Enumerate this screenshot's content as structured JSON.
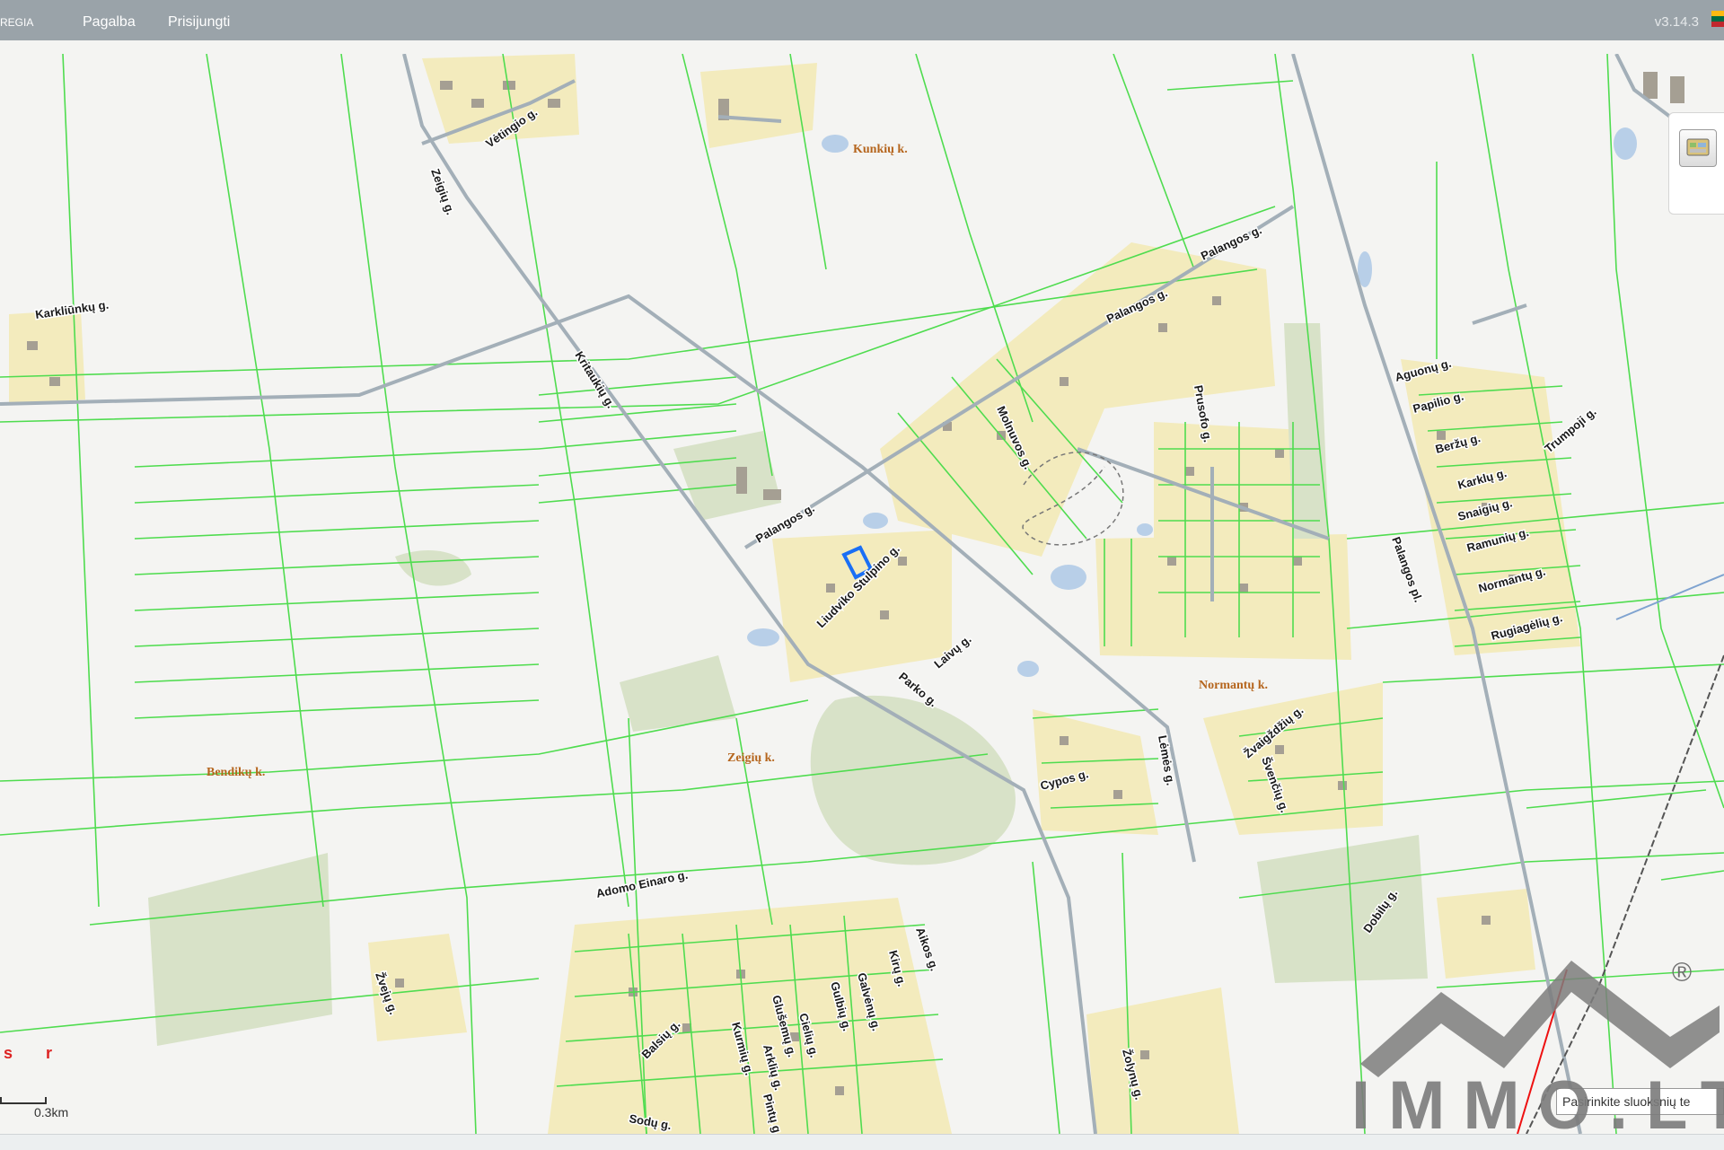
{
  "header": {
    "app_name": "REGIA",
    "menu": [
      {
        "label": "Pagalba"
      },
      {
        "label": "Prisijungti"
      }
    ],
    "version": "v3.14.3"
  },
  "map": {
    "colors": {
      "background": "#f4f4f2",
      "parcel_line": "#4fdc4f",
      "road": "#a3afb8",
      "residential": "#f3ebbd",
      "vegetation": "#d8e2c8",
      "water": "#b8cfe8",
      "building": "#a59f93",
      "village_label": "#b5651d",
      "selection": "#1a6ff5"
    },
    "village_labels": [
      {
        "text": "Kunkių k."
      },
      {
        "text": "Normantų k."
      },
      {
        "text": "Zeigių k."
      },
      {
        "text": "Bendikų k."
      }
    ],
    "street_labels": [
      {
        "text": "Vėtingio g."
      },
      {
        "text": "Zeigių g."
      },
      {
        "text": "Karkliūnkų g."
      },
      {
        "text": "Palangos g."
      },
      {
        "text": "Palangos g."
      },
      {
        "text": "Palangos g."
      },
      {
        "text": "Kritaukių g."
      },
      {
        "text": "Molnuvos g."
      },
      {
        "text": "Prusofo g."
      },
      {
        "text": "Aguonų g."
      },
      {
        "text": "Papilio g."
      },
      {
        "text": "Beržų g."
      },
      {
        "text": "Karklų g."
      },
      {
        "text": "Snaigių g."
      },
      {
        "text": "Ramunių g."
      },
      {
        "text": "Normantų g."
      },
      {
        "text": "Rugiagėlių g."
      },
      {
        "text": "Trumpoji g."
      },
      {
        "text": "Liudviko Stulpino g."
      },
      {
        "text": "Laivų g."
      },
      {
        "text": "Parko g."
      },
      {
        "text": "Palangos pl."
      },
      {
        "text": "Cypos g."
      },
      {
        "text": "Žvaigždžių g."
      },
      {
        "text": "Švenčių g."
      },
      {
        "text": "Lėmės g."
      },
      {
        "text": "Adomo Einaro g."
      },
      {
        "text": "Dobilų g."
      },
      {
        "text": "Aikos g."
      },
      {
        "text": "Kirų g."
      },
      {
        "text": "Galvėnų g."
      },
      {
        "text": "Gulbių g."
      },
      {
        "text": "Cielių g."
      },
      {
        "text": "Glušemų g."
      },
      {
        "text": "Balsių g."
      },
      {
        "text": "Kurmių g."
      },
      {
        "text": "Arklių g."
      },
      {
        "text": "Pintų g."
      },
      {
        "text": "Žvejų g."
      },
      {
        "text": "Žolynų g."
      },
      {
        "text": "Sodų g."
      }
    ],
    "scale": {
      "label": "0.3km"
    },
    "layer_select": {
      "placeholder": "Pasirinkite sluoksnių te"
    },
    "red_note": "s r",
    "watermark": {
      "text": "IMMO.LT",
      "reg": "®"
    },
    "layer_button_icon": "layers-icon"
  }
}
